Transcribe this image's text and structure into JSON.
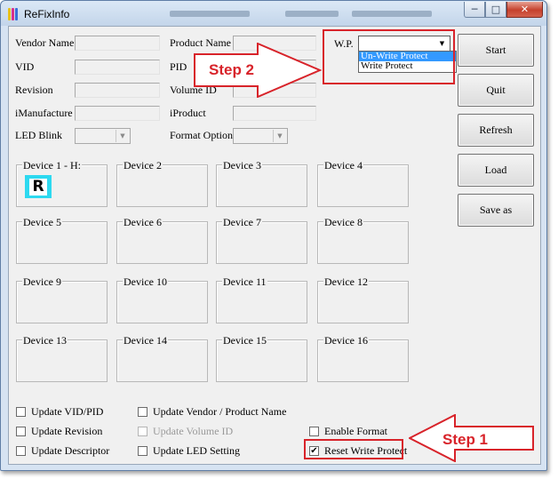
{
  "window": {
    "title": "ReFixInfo",
    "min_icon": "minimize-icon",
    "max_icon": "maximize-icon",
    "close_icon": "close-icon"
  },
  "info_fields": {
    "vendor_name": "Vendor Name",
    "product_name": "Product Name",
    "vid": "VID",
    "pid": "PID",
    "revision": "Revision",
    "volume_id": "Volume ID",
    "imanufacture": "iManufacture",
    "iproduct": "iProduct",
    "led_blink": "LED Blink",
    "format_option": "Format Option"
  },
  "wp": {
    "label": "W.P.",
    "options": [
      "Un-Write Protect",
      "Write Protect"
    ],
    "highlighted": "Un-Write Protect"
  },
  "buttons": {
    "start": "Start",
    "quit": "Quit",
    "refresh": "Refresh",
    "load": "Load",
    "save_as": "Save as"
  },
  "devices": [
    "Device 1 - H:",
    "Device 2",
    "Device 3",
    "Device 4",
    "Device 5",
    "Device 6",
    "Device 7",
    "Device 8",
    "Device 9",
    "Device 10",
    "Device 11",
    "Device 12",
    "Device 13",
    "Device 14",
    "Device 15",
    "Device 16"
  ],
  "device1_badge": "R",
  "options": {
    "update_vid_pid": "Update VID/PID",
    "update_vendor_product": "Update Vendor / Product Name",
    "update_revision": "Update Revision",
    "update_volume_id": "Update Volume ID",
    "enable_format": "Enable Format",
    "update_descriptor": "Update Descriptor",
    "update_led_setting": "Update LED Setting",
    "reset_write_protect": "Reset Write Protect"
  },
  "check_states": {
    "reset_write_protect": true
  },
  "annotations": {
    "step1": "Step 1",
    "step2": "Step 2"
  },
  "colors": {
    "annotation_red": "#d8232a",
    "selection_blue": "#3399ff",
    "badge_cyan": "#2dd9f0"
  }
}
